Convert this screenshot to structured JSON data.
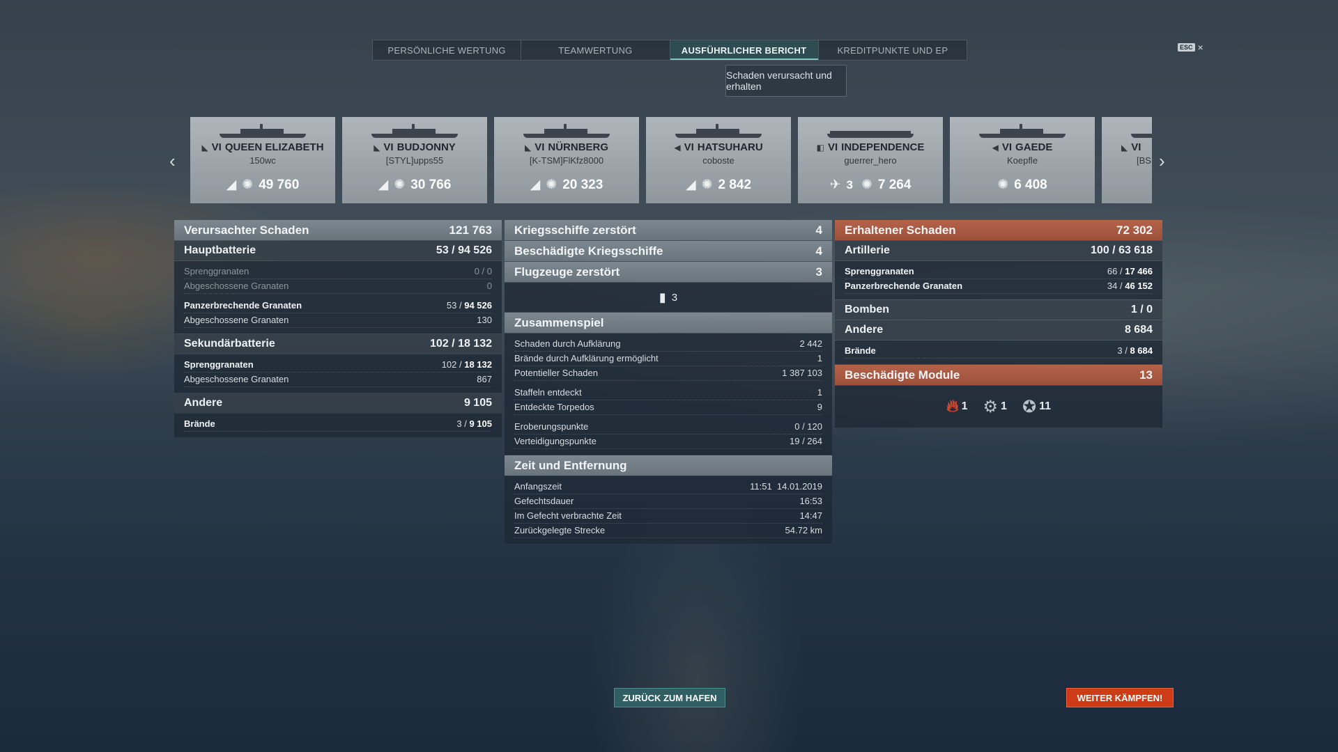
{
  "tabs": [
    {
      "label": "PERSÖNLICHE WERTUNG",
      "active": false
    },
    {
      "label": "TEAMWERTUNG",
      "active": false
    },
    {
      "label": "AUSFÜHRLICHER BERICHT",
      "active": true
    },
    {
      "label": "KREDITPUNKTE UND EP",
      "active": false
    }
  ],
  "subtab": "Schaden verursacht und erhalten",
  "esc": {
    "key": "ESC",
    "close": "×"
  },
  "carousel": {
    "prev_icon": "‹",
    "next_icon": "›",
    "cards": [
      {
        "tier": "VI",
        "ship": "QUEEN ELIZABETH",
        "player": "150wc",
        "class_icon": "battleship-icon",
        "kills": "",
        "damage": "49 760"
      },
      {
        "tier": "VI",
        "ship": "BUDJONNY",
        "player": "[STYL]upps55",
        "class_icon": "cruiser-icon",
        "kills": "",
        "damage": "30 766"
      },
      {
        "tier": "VI",
        "ship": "NÜRNBERG",
        "player": "[K-TSM]FlKfz8000",
        "class_icon": "cruiser-icon",
        "kills": "",
        "damage": "20 323"
      },
      {
        "tier": "VI",
        "ship": "HATSUHARU",
        "player": "coboste",
        "class_icon": "destroyer-icon",
        "kills": "",
        "damage": "2 842"
      },
      {
        "tier": "VI",
        "ship": "INDEPENDENCE",
        "player": "guerrer_hero",
        "class_icon": "carrier-icon",
        "kills": "3",
        "damage": "7 264"
      },
      {
        "tier": "VI",
        "ship": "GAEDE",
        "player": "Koepfle",
        "class_icon": "destroyer-icon",
        "kills": "",
        "damage": "6 408"
      },
      {
        "tier": "VI",
        "ship": "",
        "player": "[BS",
        "class_icon": "cruiser-icon",
        "kills": "",
        "damage": ""
      }
    ]
  },
  "left": {
    "title": "Verursachter Schaden",
    "total": "121 763",
    "main": {
      "title": "Hauptbatterie",
      "hit": "53",
      "dmg": "94 526"
    },
    "main_rows": [
      {
        "label": "Sprenggranaten",
        "a": "0",
        "b": "0"
      },
      {
        "label": "Abgeschossene Granaten",
        "value": "0"
      },
      {
        "label": "Panzerbrechende Granaten",
        "a": "53",
        "b": "94 526"
      },
      {
        "label": "Abgeschossene Granaten",
        "value": "130"
      }
    ],
    "secondary": {
      "title": "Sekundärbatterie",
      "hit": "102",
      "dmg": "18 132"
    },
    "secondary_rows": [
      {
        "label": "Sprenggranaten",
        "a": "102",
        "b": "18 132"
      },
      {
        "label": "Abgeschossene Granaten",
        "value": "867"
      }
    ],
    "other": {
      "title": "Andere",
      "value": "9 105"
    },
    "fires": {
      "label": "Brände",
      "a": "3",
      "b": "9 105"
    }
  },
  "middle": {
    "ships_destroyed": {
      "label": "Kriegsschiffe zerstört",
      "value": "4"
    },
    "ships_damaged": {
      "label": "Beschädigte Kriegsschiffe",
      "value": "4"
    },
    "planes": {
      "label": "Flugzeuge zerstört",
      "value": "3",
      "icon": "plane-icon",
      "count": "3"
    },
    "teamplay": {
      "title": "Zusammenspiel",
      "rows": [
        {
          "label": "Schaden durch Aufklärung",
          "value": "2 442"
        },
        {
          "label": "Brände durch Aufklärung ermöglicht",
          "value": "1"
        },
        {
          "label": "Potentieller Schaden",
          "value": "1 387 103"
        },
        {
          "label": "Staffeln entdeckt",
          "value": "1"
        },
        {
          "label": "Entdeckte Torpedos",
          "value": "9"
        },
        {
          "label": "Eroberungspunkte",
          "value": "0 / 120"
        },
        {
          "label": "Verteidigungspunkte",
          "value": "19 / 264"
        }
      ]
    },
    "time": {
      "title": "Zeit und Entfernung",
      "rows": [
        {
          "label": "Anfangszeit",
          "value": "11:51  14.01.2019"
        },
        {
          "label": "Gefechtsdauer",
          "value": "16:53"
        },
        {
          "label": "Im Gefecht verbrachte Zeit",
          "value": "14:47"
        },
        {
          "label": "Zurückgelegte Strecke",
          "value": "54.72 km"
        }
      ]
    }
  },
  "right": {
    "title": "Erhaltener Schaden",
    "total": "72 302",
    "artillery": {
      "title": "Artillerie",
      "hit": "100",
      "dmg": "63 618"
    },
    "art_rows": [
      {
        "label": "Sprenggranaten",
        "a": "66",
        "b": "17 466"
      },
      {
        "label": "Panzerbrechende Granaten",
        "a": "34",
        "b": "46 152"
      }
    ],
    "bombs": {
      "title": "Bomben",
      "value": "1 / 0"
    },
    "other": {
      "title": "Andere",
      "value": "8 684"
    },
    "fires": {
      "label": "Brände",
      "a": "3",
      "b": "8 684"
    },
    "modules": {
      "title": "Beschädigte Module",
      "value": "13",
      "items": [
        {
          "icon": "fire-module-icon",
          "count": "1"
        },
        {
          "icon": "engine-module-icon",
          "count": "1"
        },
        {
          "icon": "gun-module-icon",
          "count": "11"
        }
      ]
    }
  },
  "buttons": {
    "port": "ZURÜCK ZUM HAFEN",
    "fight": "WEITER KÄMPFEN!"
  },
  "colors": {
    "accent_orange": "#cf3b16",
    "accent_teal": "#2f5f63",
    "received_header": "#b4634a"
  }
}
